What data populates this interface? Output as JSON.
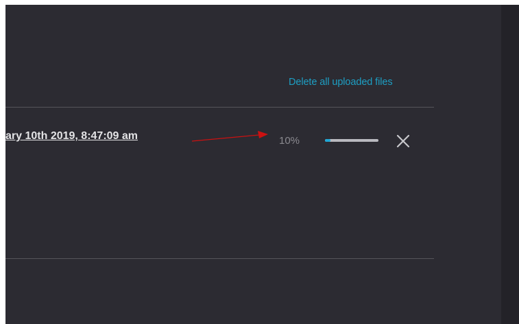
{
  "actions": {
    "delete_all_label": "Delete all uploaded files"
  },
  "upload": {
    "file_label": "ary 10th 2019, 8:47:09 am",
    "progress_text": "10%",
    "progress_value": 0.1
  },
  "colors": {
    "panel_bg": "#2c2b32",
    "accent": "#1d9fc4",
    "progress_fill": "#1ea7d6",
    "progress_track": "#b9b9bf",
    "annotation_arrow": "#cc1111"
  },
  "icons": {
    "cancel": "close-icon",
    "annotation": "red-arrow-annotation"
  }
}
